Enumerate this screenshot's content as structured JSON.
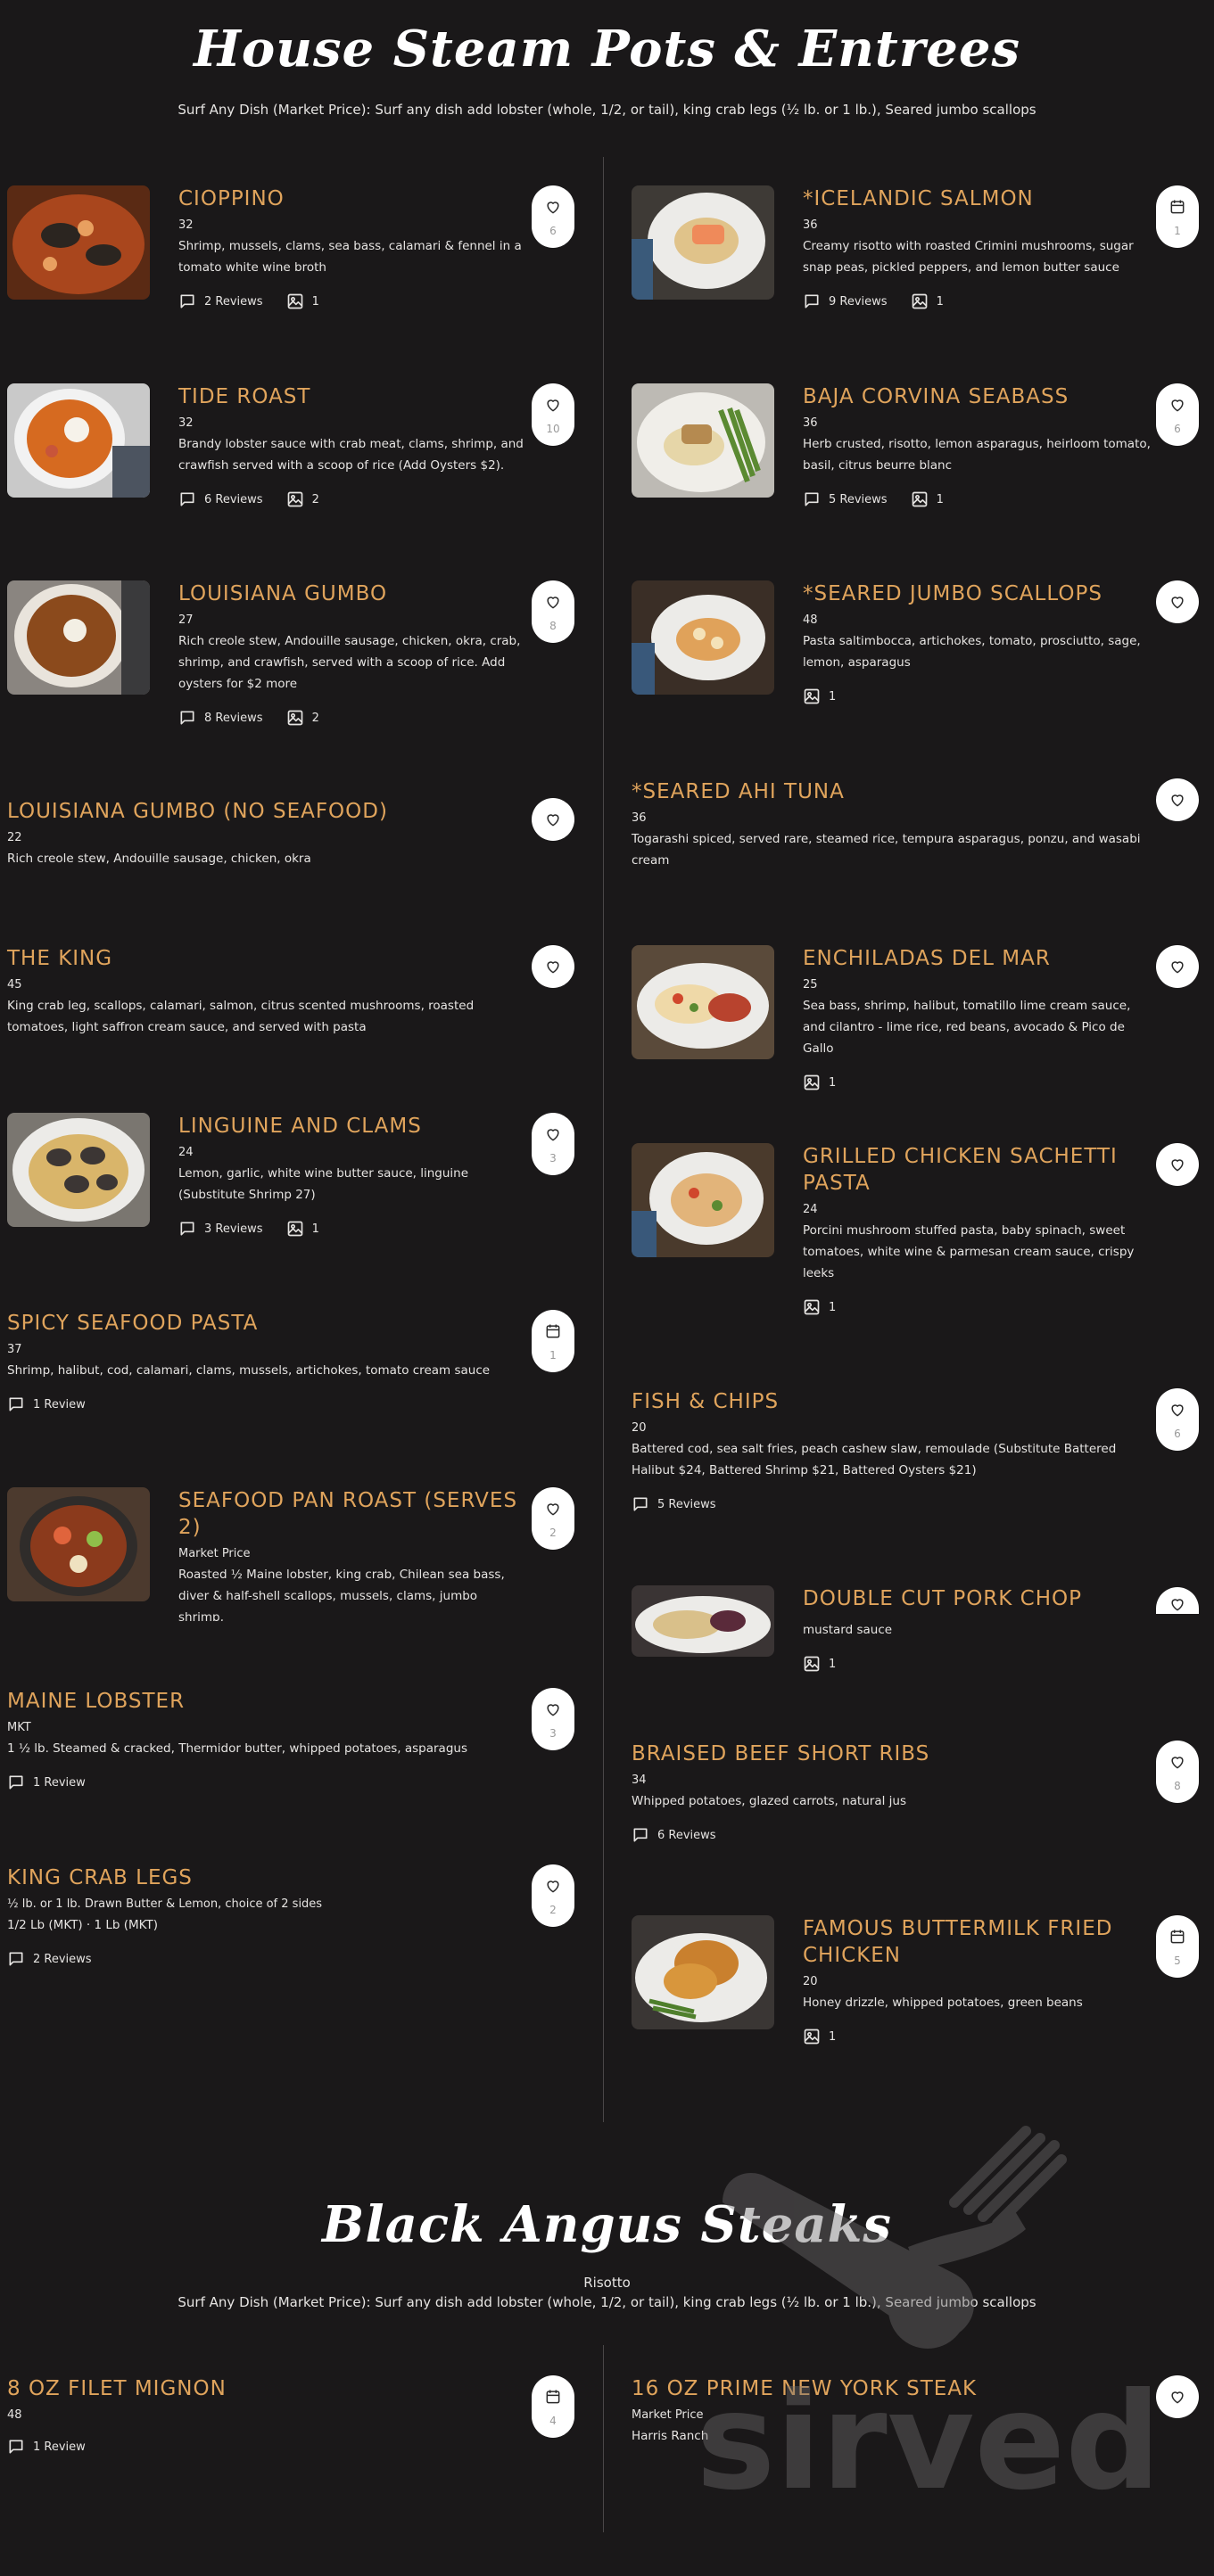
{
  "sections": [
    {
      "title": "House Steam Pots & Entrees",
      "subtitle": "Surf Any Dish (Market Price): Surf any dish add lobster (whole, 1/2, or tail), king crab legs (½ lb. or 1 lb.), Seared jumbo scallops"
    },
    {
      "title": "Black Angus Steaks",
      "note": "Risotto",
      "subtitle": "Surf Any Dish (Market Price): Surf any dish add lobster (whole, 1/2, or tail), king crab legs (½ lb. or 1 lb.), Seared jumbo scallops"
    }
  ],
  "items": [
    {
      "name": "Cioppino",
      "price": "32",
      "desc": "Shrimp, mussels, clams, sea bass, calamari & fennel in a tomato white wine broth",
      "reviews": "2 Reviews",
      "photos": "1",
      "fav_icon": "heart-icon",
      "fav_count": "6"
    },
    {
      "name": "*Icelandic Salmon",
      "price": "36",
      "desc": "Creamy risotto with roasted Crimini mushrooms, sugar snap peas, pickled peppers, and lemon butter sauce",
      "reviews": "9 Reviews",
      "photos": "1",
      "fav_icon": "calendar-icon",
      "fav_count": "1"
    },
    {
      "name": "Tide Roast",
      "price": "32",
      "desc": "Brandy lobster sauce with crab meat, clams, shrimp, and crawfish served with a scoop of rice (Add Oysters $2).",
      "reviews": "6 Reviews",
      "photos": "2",
      "fav_icon": "heart-icon",
      "fav_count": "10"
    },
    {
      "name": "Baja Corvina Seabass",
      "price": "36",
      "desc": "Herb crusted, risotto, lemon asparagus, heirloom tomato, basil, citrus beurre blanc",
      "reviews": "5 Reviews",
      "photos": "1",
      "fav_icon": "heart-icon",
      "fav_count": "6"
    },
    {
      "name": "Louisiana Gumbo",
      "price": "27",
      "desc": "Rich creole stew, Andouille sausage, chicken, okra, crab, shrimp, and crawfish, served with a scoop of rice. Add oysters for $2 more",
      "reviews": "8 Reviews",
      "photos": "2",
      "fav_icon": "heart-icon",
      "fav_count": "8"
    },
    {
      "name": "*Seared Jumbo Scallops",
      "price": "48",
      "desc": "Pasta saltimbocca, artichokes, tomato, prosciutto, sage, lemon, asparagus",
      "photos": "1",
      "fav_icon": "heart-icon"
    },
    {
      "name": "Louisiana Gumbo (No Seafood)",
      "price": "22",
      "desc": "Rich creole stew, Andouille sausage, chicken, okra",
      "fav_icon": "heart-icon"
    },
    {
      "name": "*Seared Ahi Tuna",
      "price": "36",
      "desc": "Togarashi spiced, served rare, steamed rice, tempura asparagus, ponzu, and wasabi cream",
      "fav_icon": "heart-icon"
    },
    {
      "name": "The King",
      "price": "45",
      "desc": "King crab leg, scallops, calamari, salmon, citrus scented mushrooms, roasted tomatoes, light saffron cream sauce, and served with pasta",
      "fav_icon": "heart-icon"
    },
    {
      "name": "Enchiladas Del Mar",
      "price": "25",
      "desc": "Sea bass, shrimp, halibut, tomatillo lime cream sauce, and cilantro - lime rice, red beans, avocado & Pico de Gallo",
      "photos": "1",
      "fav_icon": "heart-icon"
    },
    {
      "name": "Linguine and Clams",
      "price": "24",
      "desc": "Lemon, garlic, white wine butter sauce, linguine (Substitute Shrimp 27)",
      "reviews": "3 Reviews",
      "photos": "1",
      "fav_icon": "heart-icon",
      "fav_count": "3"
    },
    {
      "name": "Grilled Chicken Sachetti Pasta",
      "price": "24",
      "desc": "Porcini mushroom stuffed pasta, baby spinach, sweet tomatoes, white wine & parmesan cream sauce, crispy leeks",
      "photos": "1",
      "fav_icon": "heart-icon"
    },
    {
      "name": "Spicy Seafood Pasta",
      "price": "37",
      "desc": "Shrimp, halibut, cod, calamari, clams, mussels, artichokes, tomato cream sauce",
      "reviews": "1 Review",
      "fav_icon": "calendar-icon",
      "fav_count": "1"
    },
    {
      "name": "Fish & Chips",
      "price": "20",
      "desc": "Battered cod, sea salt fries, peach cashew slaw, remoulade (Substitute Battered Halibut $24, Battered Shrimp $21, Battered Oysters $21)",
      "reviews": "5 Reviews",
      "fav_icon": "heart-icon",
      "fav_count": "6"
    },
    {
      "name": "Seafood Pan Roast (Serves 2)",
      "price": "Market Price",
      "desc": "Roasted ½ Maine lobster, king crab, Chilean sea bass, diver & half-shell scallops, mussels, clams, jumbo shrimp,",
      "fav_icon": "heart-icon",
      "fav_count": "2"
    },
    {
      "name": "Double Cut Pork Chop",
      "desc": "mustard sauce",
      "photos": "1",
      "fav_icon": "heart-icon"
    },
    {
      "name": "Maine Lobster",
      "price": "MKT",
      "desc": "1 ½ lb. Steamed & cracked, Thermidor butter, whipped potatoes, asparagus",
      "reviews": "1 Review",
      "fav_icon": "heart-icon",
      "fav_count": "3"
    },
    {
      "name": "Braised Beef Short Ribs",
      "price": "34",
      "desc": "Whipped potatoes, glazed carrots, natural jus",
      "reviews": "6 Reviews",
      "fav_icon": "heart-icon",
      "fav_count": "8"
    },
    {
      "name": "King Crab Legs",
      "price": "½ lb. or 1 lb. Drawn Butter & Lemon, choice of 2 sides",
      "desc": "1/2 Lb (MKT) · 1 Lb (MKT)",
      "reviews": "2 Reviews",
      "fav_icon": "heart-icon",
      "fav_count": "2"
    },
    {
      "name": "Famous Buttermilk Fried Chicken",
      "price": "20",
      "desc": "Honey drizzle, whipped potatoes, green beans",
      "photos": "1",
      "fav_icon": "calendar-icon",
      "fav_count": "5"
    },
    {
      "name": "8 oz Filet Mignon",
      "price": "48",
      "reviews": "1 Review",
      "fav_icon": "calendar-icon",
      "fav_count": "4"
    },
    {
      "name": "16 oz Prime New York Steak",
      "price": "Market Price",
      "desc": "Harris Ranch",
      "fav_icon": "heart-icon"
    }
  ],
  "watermark": {
    "text": "sirved"
  }
}
